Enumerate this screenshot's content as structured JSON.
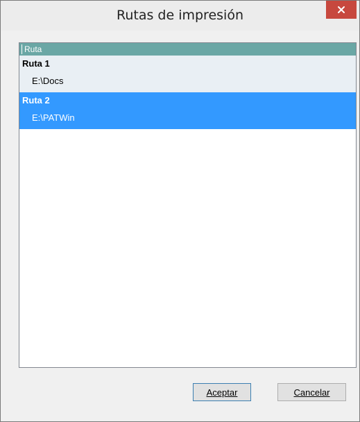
{
  "window": {
    "title": "Rutas de impresión",
    "close_icon": "close-icon"
  },
  "list": {
    "column_header": "Ruta",
    "items": [
      {
        "name": "Ruta 1",
        "path": "E:\\Docs",
        "selected": false
      },
      {
        "name": "Ruta 2",
        "path": "E:\\PATWin",
        "selected": true
      }
    ]
  },
  "buttons": {
    "accept_first": "A",
    "accept_rest": "ceptar",
    "cancel_first": "C",
    "cancel_rest": "ancelar"
  },
  "colors": {
    "close_button": "#c7483e",
    "header": "#6aa7a5",
    "selection": "#3399ff",
    "row_background": "#e9eff4"
  }
}
